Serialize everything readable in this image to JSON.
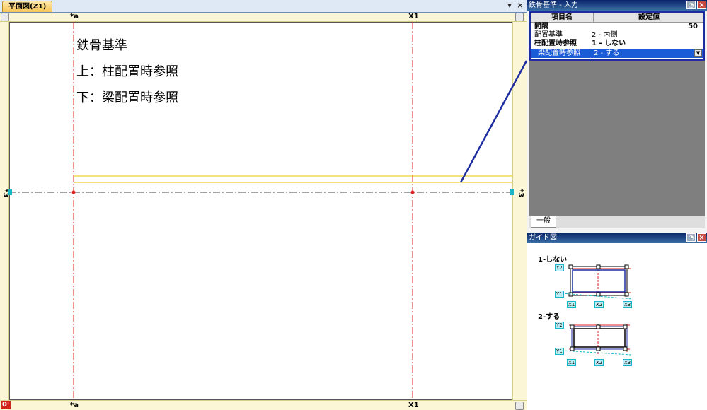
{
  "cad": {
    "tab_label": "平面図(Z1)",
    "pin_icon": "▾",
    "close_icon": "×",
    "axis_top_a": "*a",
    "axis_top_x1": "X1",
    "axis_bottom_a": "*a",
    "axis_bottom_x1": "X1",
    "axis_left": "*3",
    "axis_right": "*3",
    "origin_label": "0'",
    "note": [
      "鉄骨基準",
      "上：柱配置時参照",
      "下：梁配置時参照"
    ]
  },
  "input_panel": {
    "title": "鉄骨基準 - 入力",
    "col_item": "項目名",
    "col_value": "設定値",
    "rows": [
      {
        "name": "間隔",
        "value": "50"
      },
      {
        "name": "配置基準",
        "value": "2 - 内側"
      },
      {
        "name": "柱配置時参照",
        "value": "1 - しない"
      },
      {
        "name": "梁配置時参照",
        "value": "2 - する"
      }
    ],
    "tab": "一般"
  },
  "guide_panel": {
    "title": "ガイド図",
    "option1": "1-しない",
    "option2": "2-する",
    "labels": {
      "y2": "Y2",
      "y1": "Y1",
      "x1": "X1",
      "x2": "X2",
      "x3": "X3"
    }
  },
  "colors": {
    "axis": "#e0201c",
    "beam": "#e8c400",
    "highlight": "#1d2ca0",
    "selected_row": "#1a5bd8"
  }
}
